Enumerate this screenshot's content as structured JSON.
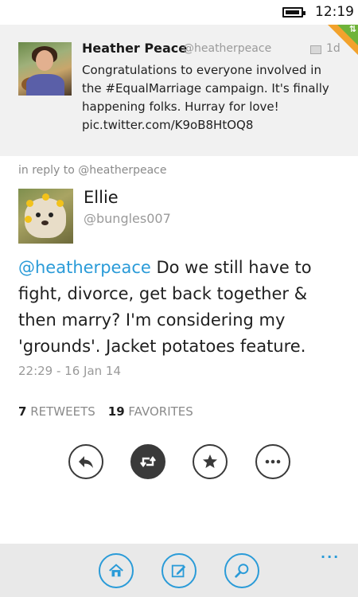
{
  "status_bar": {
    "time": "12:19",
    "battery_icon": "battery-full-icon"
  },
  "original_tweet": {
    "name": "Heather Peace",
    "handle": "@heatherpeace",
    "age": "1d",
    "text": "Congratulations to everyone involved in the #EqualMarriage campaign. It's finally happening folks. Hurray for love! pic.twitter.com/K9oB8HtOQ8"
  },
  "reply_to": "in reply to @heatherpeace",
  "tweet": {
    "name": "Ellie",
    "handle": "@bungles007",
    "mention": "@heatherpeace",
    "text": " Do we still have to fight, divorce, get back together & then marry? I'm considering my 'grounds'. Jacket potatoes feature.",
    "timestamp": "22:29 - 16 Jan 14"
  },
  "stats": {
    "retweets_count": "7",
    "retweets_label": "RETWEETS",
    "favorites_count": "19",
    "favorites_label": "FAVORITES"
  },
  "actions": [
    "reply-icon",
    "retweet-icon",
    "favorite-icon",
    "more-icon"
  ],
  "app_bar": {
    "more": "...",
    "buttons": [
      "home-icon",
      "compose-icon",
      "search-icon"
    ]
  },
  "colors": {
    "accent": "#2a9bd8",
    "card_bg": "#f1f1f1",
    "app_bar_bg": "#e9e9e9"
  }
}
